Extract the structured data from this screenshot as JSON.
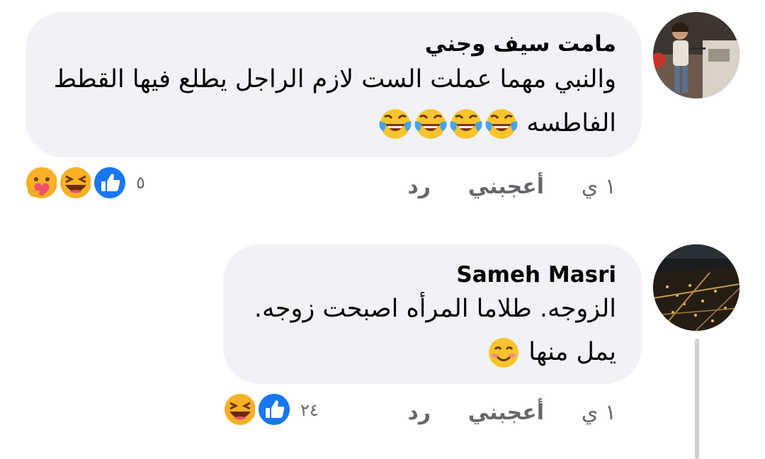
{
  "comments": [
    {
      "author": "مامت سيف وجني",
      "text_line1": "والنبي مهما عملت الست لازم الراجل يطلع فيها القطط",
      "text_line2": "الفاطسه",
      "text_emojis": [
        "tears-of-joy-emoji",
        "tears-of-joy-emoji",
        "tears-of-joy-emoji",
        "tears-of-joy-emoji"
      ],
      "time": "١ ي",
      "like_label": "أعجبني",
      "reply_label": "رد",
      "reaction_count": "٥",
      "reactions": [
        "like-icon",
        "haha-icon",
        "care-icon"
      ]
    },
    {
      "author": "Sameh Masri",
      "text_line1": "الزوجه. طلاما المرأه اصبحت زوجه.",
      "text_line2": "يمل منها",
      "text_emojis": [
        "smiling-face-emoji"
      ],
      "time": "١ ي",
      "like_label": "أعجبني",
      "reply_label": "رد",
      "reaction_count": "٢٤",
      "reactions": [
        "like-icon",
        "haha-icon"
      ]
    }
  ],
  "colors": {
    "bubble": "#f0f2f5",
    "secondary_text": "#65676b",
    "like_blue": "#1877f2",
    "haha_yellow": "#f7b125",
    "thread_line": "#ced0d4"
  }
}
